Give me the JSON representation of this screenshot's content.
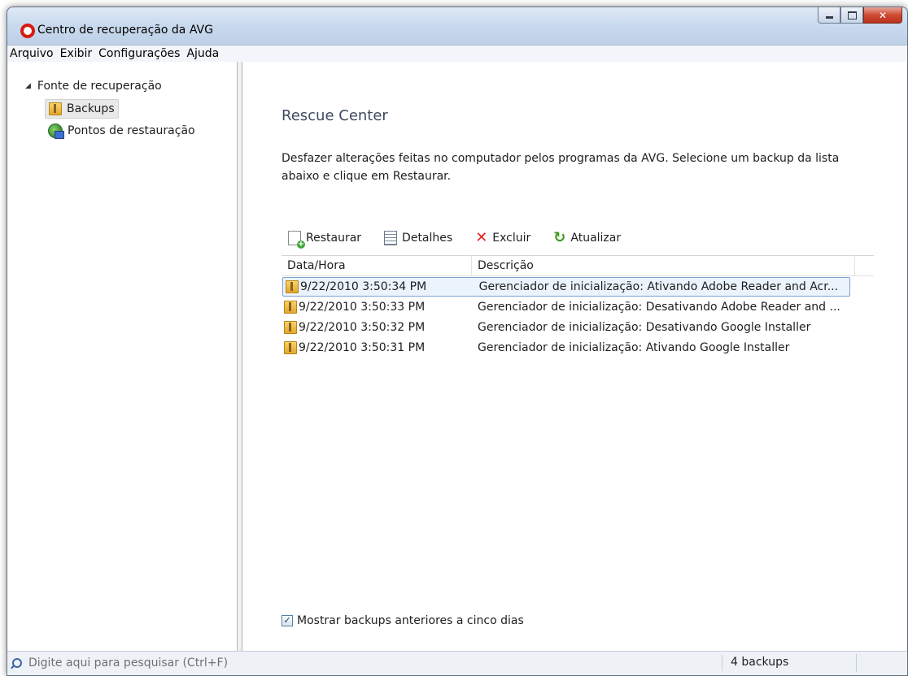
{
  "window": {
    "title": "Centro de recuperação da AVG"
  },
  "menu": {
    "items": [
      "Arquivo",
      "Exibir",
      "Configurações",
      "Ajuda"
    ]
  },
  "sidebar": {
    "root_label": "Fonte de recuperação",
    "items": [
      {
        "label": "Backups",
        "icon": "backup-folder-icon",
        "selected": true
      },
      {
        "label": "Pontos de restauração",
        "icon": "restore-point-icon",
        "selected": false
      }
    ]
  },
  "main": {
    "heading": "Rescue Center",
    "description": "Desfazer alterações feitas no computador pelos programas da AVG. Selecione um backup da lista abaixo e clique em Restaurar.",
    "toolbar": {
      "restore": "Restaurar",
      "details": "Detalhes",
      "delete": "Excluir",
      "refresh": "Atualizar"
    },
    "columns": [
      "Data/Hora",
      "Descrição"
    ],
    "rows": [
      {
        "date": "9/22/2010 3:50:34 PM",
        "description": "Gerenciador de inicialização: Ativando Adobe Reader and Acr...",
        "selected": true
      },
      {
        "date": "9/22/2010 3:50:33 PM",
        "description": "Gerenciador de inicialização: Desativando Adobe Reader and ...",
        "selected": false
      },
      {
        "date": "9/22/2010 3:50:32 PM",
        "description": "Gerenciador de inicialização: Desativando Google Installer",
        "selected": false
      },
      {
        "date": "9/22/2010 3:50:31 PM",
        "description": "Gerenciador de inicialização: Ativando Google Installer",
        "selected": false
      }
    ],
    "show_older_label": "Mostrar backups anteriores a cinco dias",
    "show_older_checked": true
  },
  "statusbar": {
    "search_placeholder": "Digite aqui para pesquisar (Ctrl+F)",
    "count": "4 backups"
  },
  "colors": {
    "accent": "#d61c12",
    "selection_bg": "#ebf4fd",
    "selection_border": "#7da2ce",
    "heading": "#3c4b5e"
  }
}
